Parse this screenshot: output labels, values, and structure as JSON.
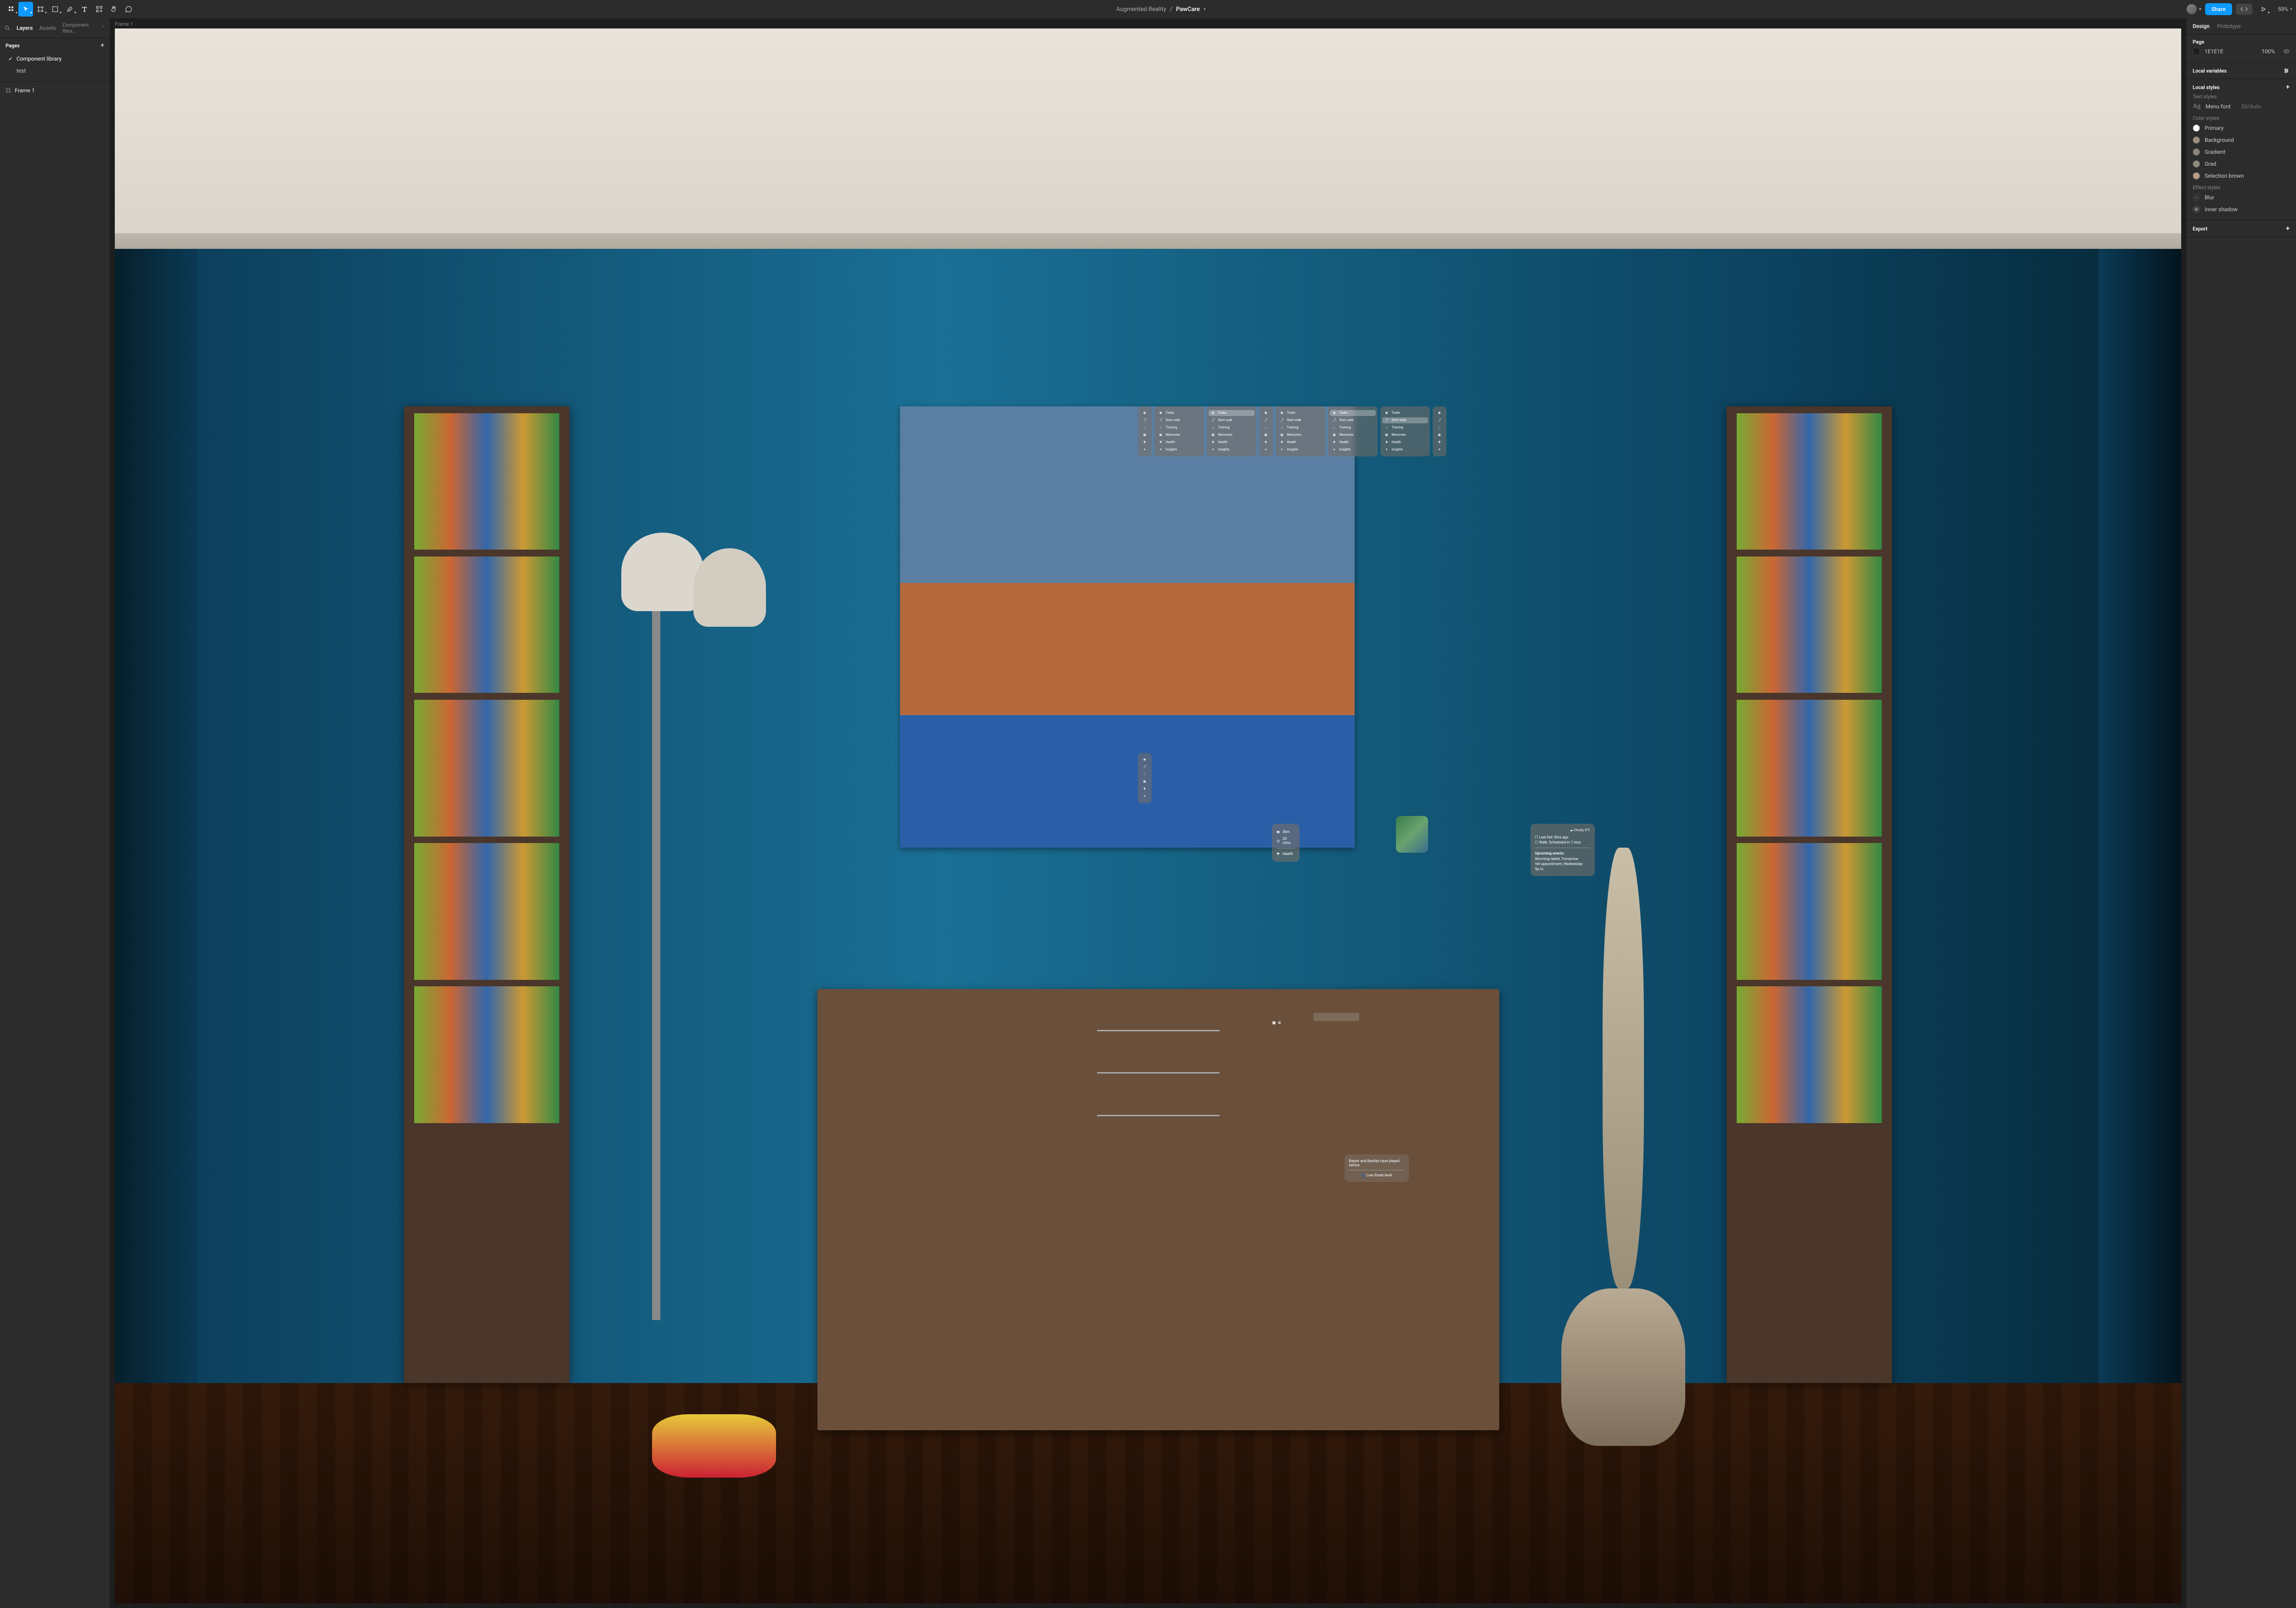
{
  "toolbar": {
    "project_parent": "Augmented Reality",
    "project_name": "PawCare",
    "share_label": "Share",
    "zoom": "59%"
  },
  "left_panel": {
    "tabs": {
      "layers": "Layers",
      "assets": "Assets",
      "library": "Component libra..."
    },
    "pages_header": "Pages",
    "pages": [
      {
        "name": "Component library",
        "active": true
      },
      {
        "name": "test",
        "active": false
      }
    ],
    "layers": [
      {
        "name": "Frame 1"
      }
    ]
  },
  "canvas": {
    "frame_label": "Frame 1",
    "menu_items": [
      {
        "icon": "◉",
        "label": "Tasks"
      },
      {
        "icon": "⤴",
        "label": "Start walk"
      },
      {
        "icon": "⌂",
        "label": "Training"
      },
      {
        "icon": "▣",
        "label": "Memories"
      },
      {
        "icon": "✚",
        "label": "Health"
      },
      {
        "icon": "✦",
        "label": "Insights"
      }
    ],
    "menu_active_tasks": 2,
    "menu_active_startwalk": 5,
    "health_card": {
      "distance": "3km",
      "duration": "20 mins",
      "label": "Health"
    },
    "sched_card": {
      "weather": "Cloudy, 8°C",
      "fed": "Last fed: 8hrs ago",
      "walk": "Walk: Scheduled in 1 hour",
      "upcoming_h": "Upcoming events:",
      "ev1": "Worming tablet, Tomorrow",
      "ev2": "Vet appointment, Wednesday 5p.m."
    },
    "threat_card": {
      "msg": "Baxter and Bentley have played before.",
      "level": "Low threat level"
    }
  },
  "right_panel": {
    "tabs": {
      "design": "Design",
      "prototype": "Prototype"
    },
    "page_h": "Page",
    "page_hex": "1E1E1E",
    "page_opacity": "100%",
    "local_vars": "Local variables",
    "local_styles": "Local styles",
    "text_styles_h": "Text styles",
    "text_style": {
      "name": "Menu font",
      "detail": "50/Auto"
    },
    "color_styles_h": "Color styles",
    "colors": [
      {
        "name": "Primary",
        "hex": "#ffffff"
      },
      {
        "name": "Background",
        "hex": "#9b8e7e"
      },
      {
        "name": "Gradient",
        "hex": "#8a8478"
      },
      {
        "name": "Grad",
        "hex": "#8f897e"
      },
      {
        "name": "Selection brown",
        "hex": "#b69b88"
      }
    ],
    "effect_styles_h": "Effect styles",
    "effects": [
      {
        "name": "Blur",
        "icon": "blur"
      },
      {
        "name": "Inner shadow",
        "icon": "inner"
      }
    ],
    "export_h": "Export"
  }
}
